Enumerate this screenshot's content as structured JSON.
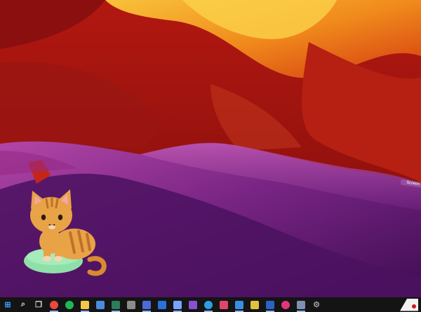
{
  "desktop": {
    "wallpaper": "antelope-canyon-sandstone",
    "colors": {
      "sky": "#f5a11a",
      "orange": "#d43a10",
      "red": "#a0140f",
      "magenta": "#a63a9a",
      "purple": "#5a1b6e",
      "deep": "#3a0b4a"
    }
  },
  "pet": {
    "name": "tabby-cat-desktop-pet",
    "cushion_color": "#8fe0a8",
    "fur_color": "#e8a347"
  },
  "screen_tag": "Screen",
  "taskbar": {
    "background": "#141414",
    "items": [
      {
        "icon": "windows-start-icon",
        "color": "#3aa0ff"
      },
      {
        "icon": "search-icon",
        "color": "#dddddd"
      },
      {
        "icon": "task-view-icon",
        "color": "#dddddd"
      },
      {
        "icon": "chrome-icon",
        "color": "#e84a3c"
      },
      {
        "icon": "spotify-icon",
        "color": "#1db954"
      },
      {
        "icon": "file-explorer-icon",
        "color": "#f3c84a"
      },
      {
        "icon": "chart-app-icon",
        "color": "#4a8bdc"
      },
      {
        "icon": "terminal-icon",
        "color": "#2d7c5a"
      },
      {
        "icon": "media-app-icon",
        "color": "#8c8c8c"
      },
      {
        "icon": "teams-icon",
        "color": "#4a6bd8"
      },
      {
        "icon": "outlook-icon",
        "color": "#2a72d6"
      },
      {
        "icon": "paint-icon",
        "color": "#7aa3ff"
      },
      {
        "icon": "notes-icon",
        "color": "#8a4fd1"
      },
      {
        "icon": "edge-icon",
        "color": "#2d9fe0"
      },
      {
        "icon": "intellij-icon",
        "color": "#e2456c"
      },
      {
        "icon": "vpn-icon",
        "color": "#3a8de0"
      },
      {
        "icon": "pycharm-icon",
        "color": "#e0c33a"
      },
      {
        "icon": "word-icon",
        "color": "#2a63c4"
      },
      {
        "icon": "music-app-icon",
        "color": "#e2367a"
      },
      {
        "icon": "gamepad-icon",
        "color": "#7f8fae"
      },
      {
        "icon": "settings-icon",
        "color": "#9a9a9a"
      }
    ]
  }
}
